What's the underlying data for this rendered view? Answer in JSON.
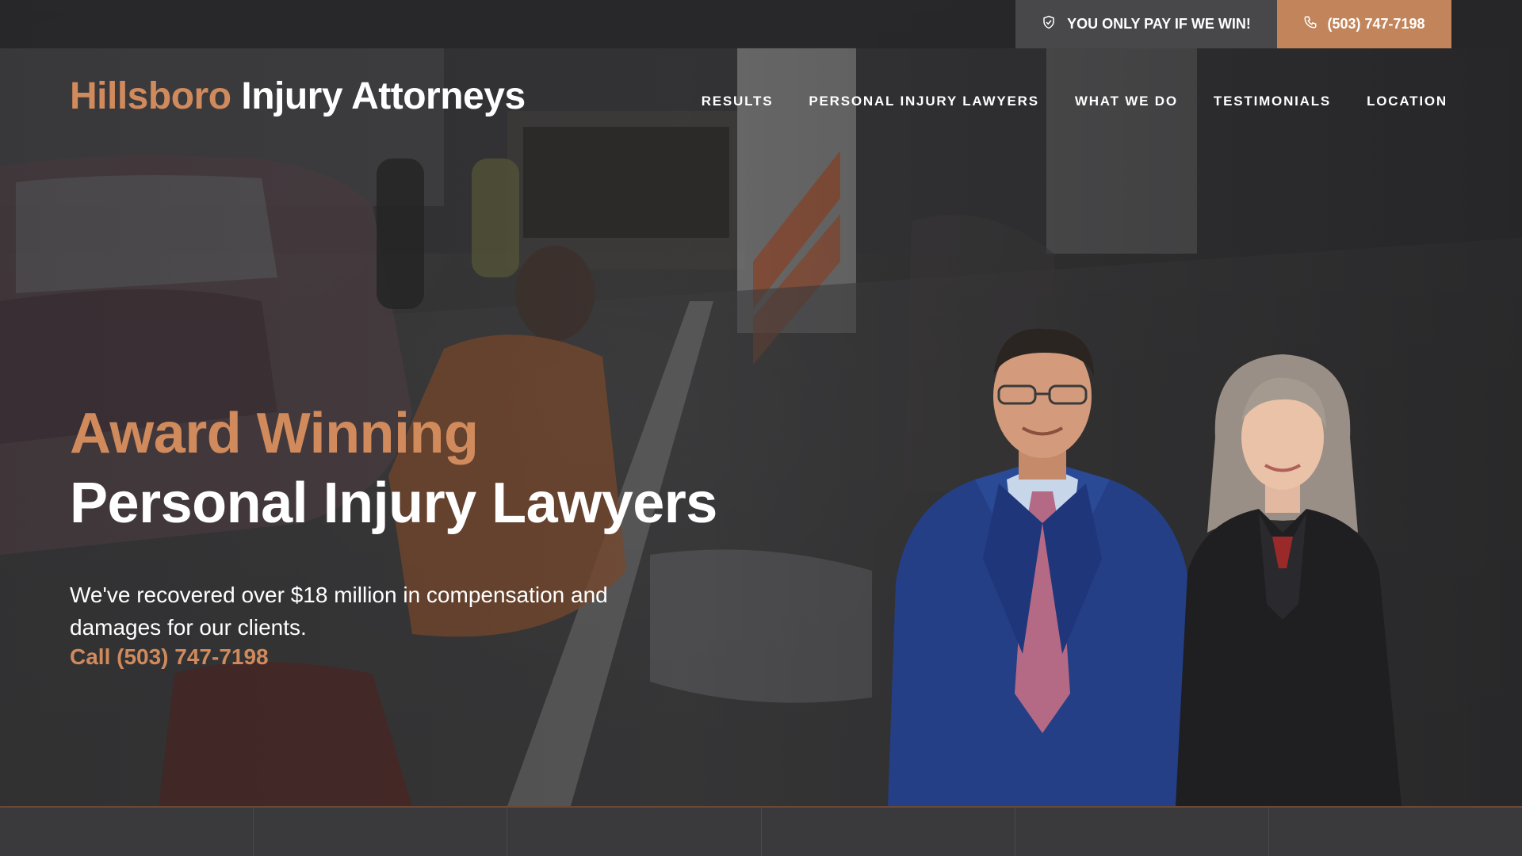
{
  "topbar": {
    "promise_text": "YOU ONLY PAY IF WE WIN!",
    "promise_icon": "shield-check-icon",
    "phone_text": "(503) 747-7198",
    "phone_icon": "phone-icon"
  },
  "brand": {
    "logo_part1": "Hillsboro",
    "logo_part2": "Injury Attorneys",
    "accent_color": "#d08a5c"
  },
  "nav": {
    "items": [
      {
        "label": "RESULTS"
      },
      {
        "label": "PERSONAL INJURY LAWYERS"
      },
      {
        "label": "WHAT WE DO"
      },
      {
        "label": "TESTIMONIALS"
      },
      {
        "label": "LOCATION"
      }
    ]
  },
  "hero": {
    "headline_accent": "Award Winning",
    "headline_main": "Personal Injury Lawyers",
    "subtext": "We've recovered over $18 million in compensation and damages for our clients.",
    "call_text": "Call (503) 747-7198"
  }
}
